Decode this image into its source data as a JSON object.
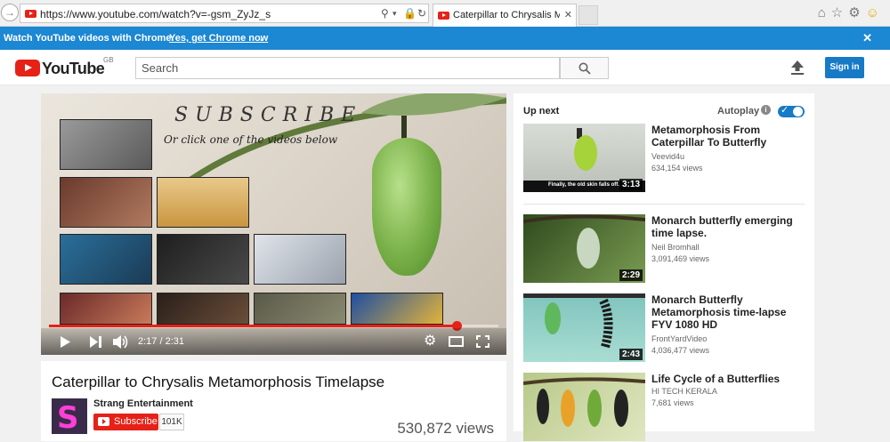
{
  "browser": {
    "url": "https://www.youtube.com/watch?v=-gsm_ZyJz_s",
    "tab_title": "Caterpillar to Chrysalis Met...",
    "tab_close": "✕"
  },
  "infobar": {
    "message": "Watch YouTube videos with Chrome.",
    "action": "Yes, get Chrome now",
    "action_suffix": ".",
    "close": "✕"
  },
  "masthead": {
    "logo_text": "YouTube",
    "region": "GB",
    "search_placeholder": "Search",
    "signin_label": "Sign in"
  },
  "player": {
    "overlay_title": "SUBSCRIBE",
    "overlay_subtitle": "Or click one of the videos below",
    "current_time": "2:17",
    "duration": "2:31",
    "progress": 0.907
  },
  "video": {
    "title": "Caterpillar to Chrysalis Metamorphosis Timelapse",
    "channel": "Strang Entertainment",
    "avatar_letter": "S",
    "subscribe_label": "Subscribe",
    "subscriber_count": "101K",
    "views": "530,872 views"
  },
  "sidebar": {
    "up_next": "Up next",
    "autoplay": "Autoplay",
    "info": "i",
    "autoplay_on": true,
    "items": [
      {
        "title": "Metamorphosis From Caterpillar To Butterfly",
        "channel": "Veevid4u",
        "views": "634,154 views",
        "duration": "3:13",
        "caption": "Finally, the old skin falls off."
      },
      {
        "title": "Monarch butterfly emerging time lapse.",
        "channel": "Neil Bromhall",
        "views": "3,091,469 views",
        "duration": "2:29"
      },
      {
        "title": "Monarch Butterfly Metamorphosis time-lapse FYV 1080 HD",
        "channel": "FrontYardVideo",
        "views": "4,036,477 views",
        "duration": "2:43"
      },
      {
        "title": "Life Cycle of a Butterflies",
        "channel": "HI TECH KERALA",
        "views": "7,681 views"
      }
    ]
  },
  "colors": {
    "brand_red": "#e62117",
    "accent_blue": "#167ac6",
    "infobar_blue": "#1c87d3"
  }
}
